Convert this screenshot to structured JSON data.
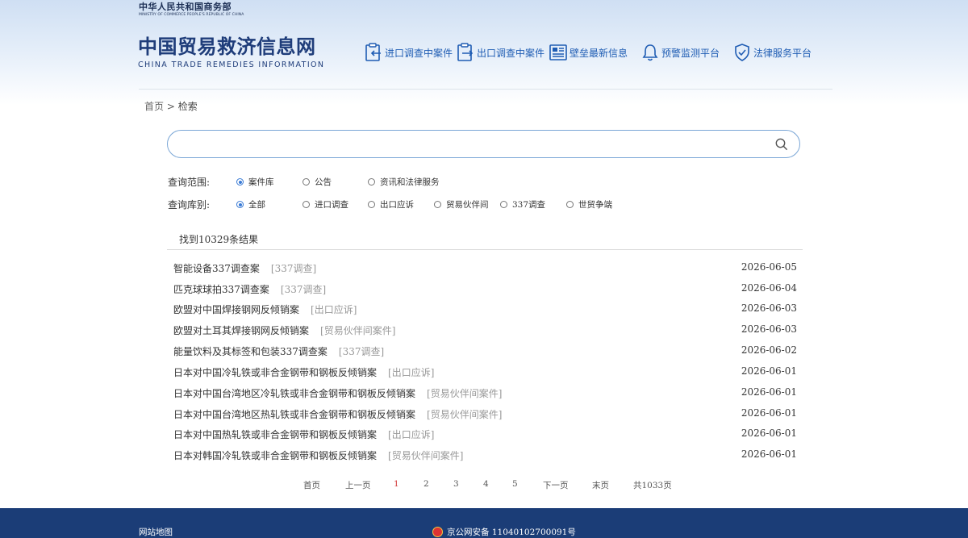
{
  "header": {
    "ministry_cn": "中华人民共和国商务部",
    "ministry_en": "MINISTRY OF COMMERCE PEOPLE'S REPUBLIC OF CHINA",
    "logo_cn": "中国贸易救济信息网",
    "logo_en": "CHINA TRADE REMEDIES INFORMATION",
    "nav": [
      {
        "label": "进口调查中案件",
        "icon": "import-case-icon"
      },
      {
        "label": "出口调查中案件",
        "icon": "export-case-icon"
      },
      {
        "label": "壁垒最新信息",
        "icon": "news-icon"
      },
      {
        "label": "预警监测平台",
        "icon": "bell-icon"
      },
      {
        "label": "法律服务平台",
        "icon": "shield-check-icon"
      }
    ]
  },
  "breadcrumb": {
    "home": "首页",
    "separator": ">",
    "current": "检索"
  },
  "search": {
    "value": "",
    "placeholder": ""
  },
  "filters": {
    "scope_label": "查询范围:",
    "scope_options": [
      "案件库",
      "公告",
      "资讯和法律服务"
    ],
    "scope_selected": 0,
    "library_label": "查询库别:",
    "library_options": [
      "全部",
      "进口调查",
      "出口应诉",
      "贸易伙伴间",
      "337调查",
      "世贸争端"
    ],
    "library_selected": 0
  },
  "results": {
    "count_text": "找到10329条结果",
    "items": [
      {
        "title": "智能设备337调查案",
        "category": "[337调查]",
        "date": "2026-06-05"
      },
      {
        "title": "匹克球球拍337调查案",
        "category": "[337调查]",
        "date": "2026-06-04"
      },
      {
        "title": "欧盟对中国焊接钢网反倾销案",
        "category": "[出口应诉]",
        "date": "2026-06-03"
      },
      {
        "title": "欧盟对土耳其焊接钢网反倾销案",
        "category": "[贸易伙伴间案件]",
        "date": "2026-06-03"
      },
      {
        "title": "能量饮料及其标签和包装337调查案",
        "category": "[337调查]",
        "date": "2026-06-02"
      },
      {
        "title": "日本对中国冷轧铁或非合金钢带和钢板反倾销案",
        "category": "[出口应诉]",
        "date": "2026-06-01"
      },
      {
        "title": "日本对中国台湾地区冷轧铁或非合金钢带和钢板反倾销案",
        "category": "[贸易伙伴间案件]",
        "date": "2026-06-01"
      },
      {
        "title": "日本对中国台湾地区热轧铁或非合金钢带和钢板反倾销案",
        "category": "[贸易伙伴间案件]",
        "date": "2026-06-01"
      },
      {
        "title": "日本对中国热轧铁或非合金钢带和钢板反倾销案",
        "category": "[出口应诉]",
        "date": "2026-06-01"
      },
      {
        "title": "日本对韩国冷轧铁或非合金钢带和钢板反倾销案",
        "category": "[贸易伙伴间案件]",
        "date": "2026-06-01"
      }
    ]
  },
  "pagination": {
    "first": "首页",
    "prev": "上一页",
    "pages": [
      "1",
      "2",
      "3",
      "4",
      "5"
    ],
    "current": "1",
    "next": "下一页",
    "last": "末页",
    "total": "共1033页"
  },
  "footer": {
    "sitemap": "网站地图",
    "beian": "京公网安备 11040102700091号"
  },
  "colors": {
    "nav_text": "#1e5cb3",
    "logo": "#1f3d7a",
    "footer_bg": "#1b3d77",
    "active_page": "#d23a3a",
    "radio_selected": "#3a7bd5"
  }
}
